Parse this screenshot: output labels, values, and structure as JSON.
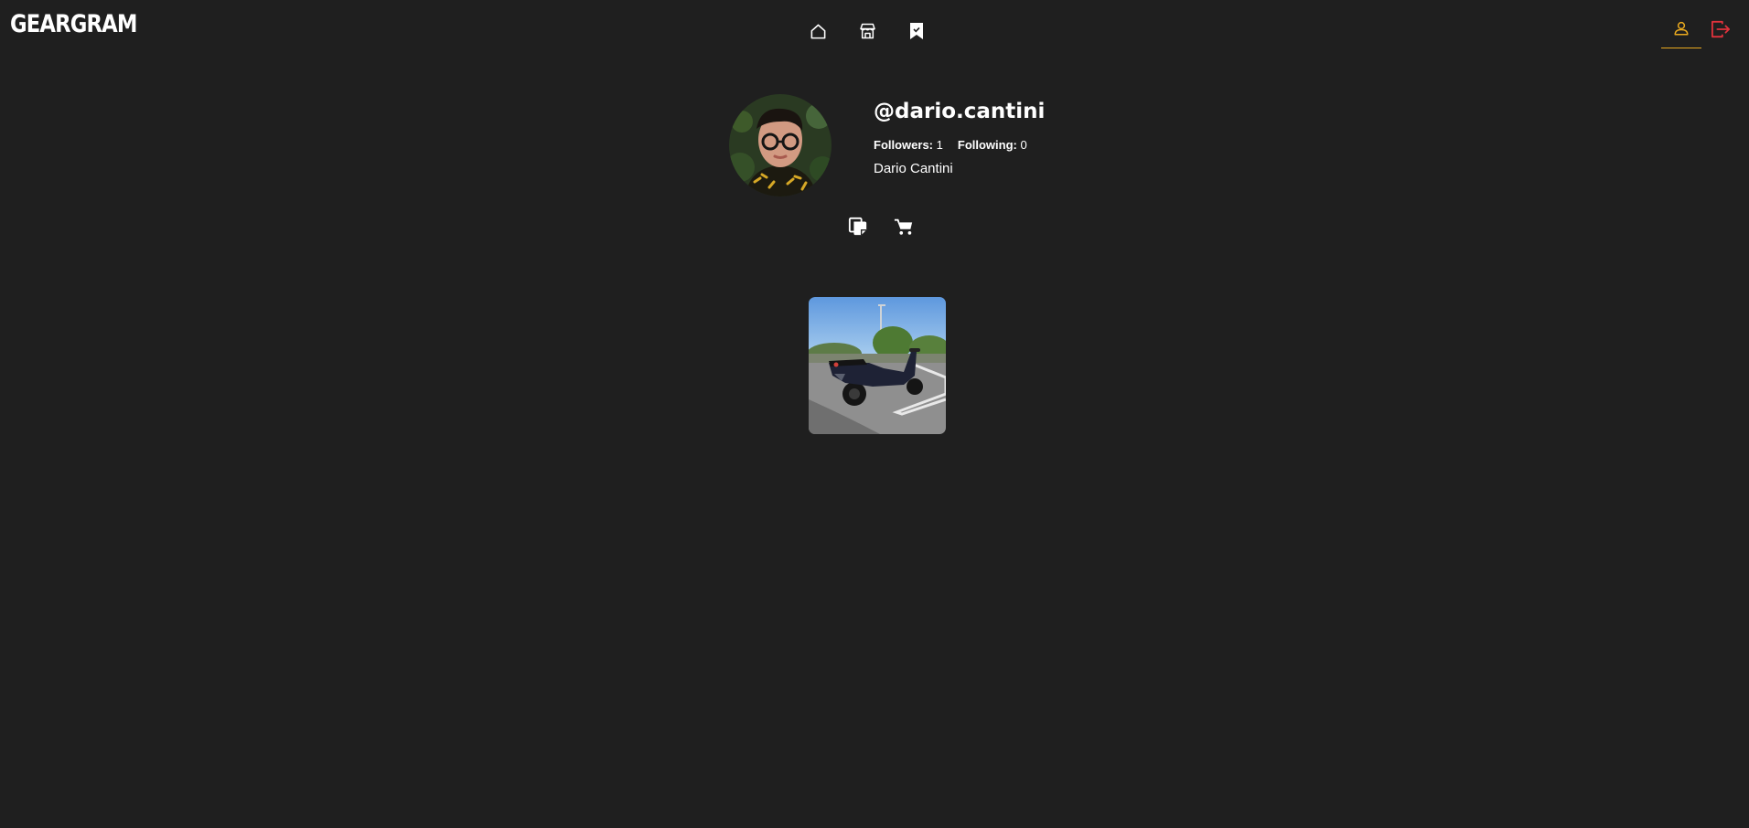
{
  "brand": {
    "name": "GEARGRAM"
  },
  "nav": {
    "center": [
      {
        "icon": "home-icon"
      },
      {
        "icon": "store-icon"
      },
      {
        "icon": "saved-bookmark-icon"
      }
    ],
    "right": [
      {
        "icon": "user-icon",
        "active": true
      },
      {
        "icon": "logout-icon"
      }
    ]
  },
  "profile": {
    "username": "@dario.cantini",
    "followers_label": "Followers:",
    "followers": "1",
    "following_label": "Following:",
    "following": "0",
    "full_name": "Dario Cantini"
  },
  "tabs": [
    {
      "icon": "posts-icon"
    },
    {
      "icon": "cart-icon"
    }
  ],
  "posts": [
    {
      "subject": "scooter"
    }
  ],
  "colors": {
    "background": "#1f1f1f",
    "accent": "#e9a91f",
    "logout": "#e0323c",
    "text": "#ffffff"
  }
}
